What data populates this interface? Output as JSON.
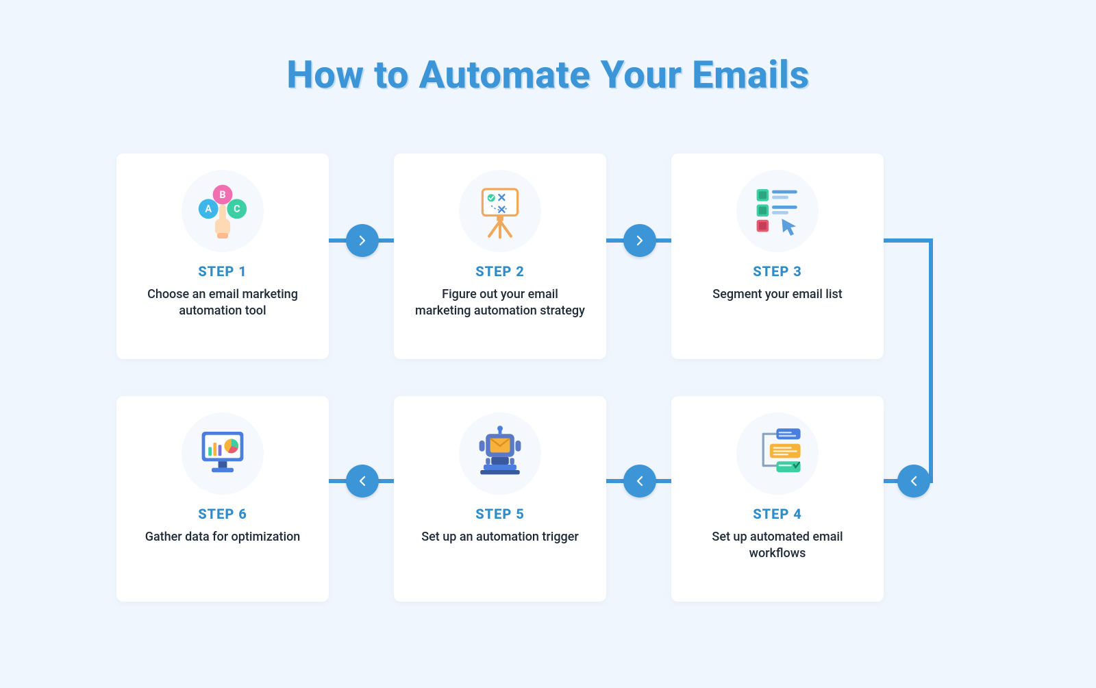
{
  "title": "How to Automate Your Emails",
  "steps": [
    {
      "label": "STEP 1",
      "desc": "Choose an email marketing automation tool",
      "icon": "abc-choose-icon"
    },
    {
      "label": "STEP 2",
      "desc": "Figure out your email marketing automation strategy",
      "icon": "strategy-easel-icon"
    },
    {
      "label": "STEP 3",
      "desc": "Segment your email list",
      "icon": "segment-list-icon"
    },
    {
      "label": "STEP 4",
      "desc": "Set up automated email workflows",
      "icon": "workflow-chat-icon"
    },
    {
      "label": "STEP 5",
      "desc": "Set up an automation trigger",
      "icon": "robot-trigger-icon"
    },
    {
      "label": "STEP 6",
      "desc": "Gather data for optimization",
      "icon": "analytics-monitor-icon"
    }
  ],
  "colors": {
    "accent": "#3b95d6",
    "card_bg": "#ffffff",
    "page_bg": "#f0f6fd",
    "text": "#1f2a37"
  }
}
